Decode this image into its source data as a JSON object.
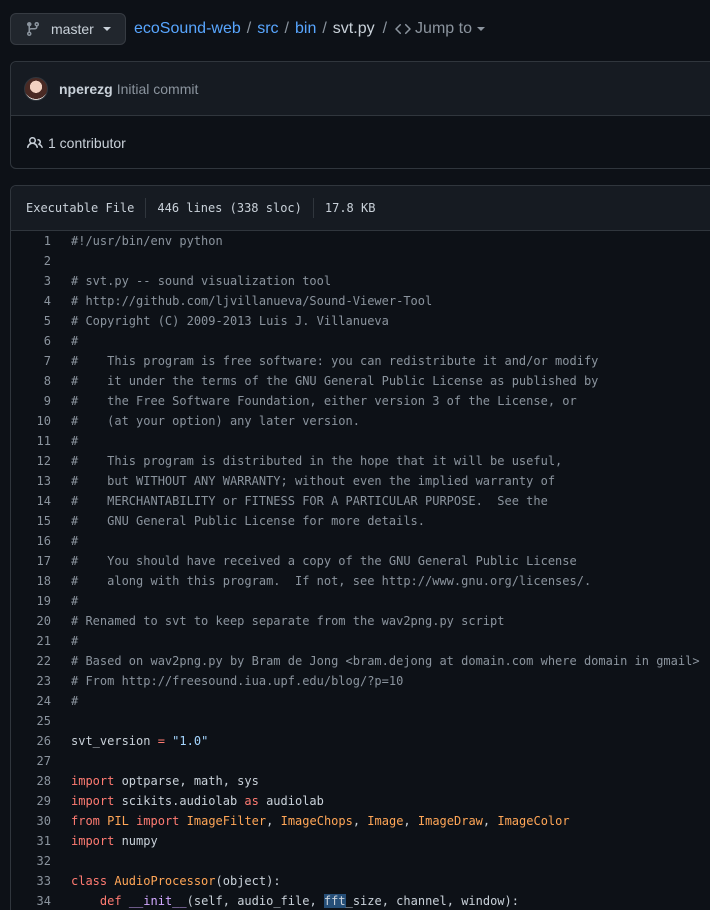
{
  "branch": {
    "name": "master",
    "icon": "git-branch-icon"
  },
  "breadcrumb": {
    "repo": "ecoSound-web",
    "parts": [
      "src",
      "bin"
    ],
    "file": "svt.py",
    "jump_label": "Jump to"
  },
  "commit": {
    "author": "nperezg",
    "message": "Initial commit"
  },
  "contributors": {
    "label": "1 contributor"
  },
  "file_info": {
    "mode": "Executable File",
    "lines": "446 lines (338 sloc)",
    "size": "17.8 KB"
  },
  "code_lines": [
    {
      "n": "1",
      "html": "<span class=\"c\">#!/usr/bin/env python</span>"
    },
    {
      "n": "2",
      "html": ""
    },
    {
      "n": "3",
      "html": "<span class=\"c\"># svt.py -- sound visualization tool</span>"
    },
    {
      "n": "4",
      "html": "<span class=\"c\"># http://github.com/ljvillanueva/Sound-Viewer-Tool</span>"
    },
    {
      "n": "5",
      "html": "<span class=\"c\"># Copyright (C) 2009-2013 Luis J. Villanueva</span>"
    },
    {
      "n": "6",
      "html": "<span class=\"c\">#</span>"
    },
    {
      "n": "7",
      "html": "<span class=\"c\">#    This program is free software: you can redistribute it and/or modify</span>"
    },
    {
      "n": "8",
      "html": "<span class=\"c\">#    it under the terms of the GNU General Public License as published by</span>"
    },
    {
      "n": "9",
      "html": "<span class=\"c\">#    the Free Software Foundation, either version 3 of the License, or</span>"
    },
    {
      "n": "10",
      "html": "<span class=\"c\">#    (at your option) any later version.</span>"
    },
    {
      "n": "11",
      "html": "<span class=\"c\">#</span>"
    },
    {
      "n": "12",
      "html": "<span class=\"c\">#    This program is distributed in the hope that it will be useful,</span>"
    },
    {
      "n": "13",
      "html": "<span class=\"c\">#    but WITHOUT ANY WARRANTY; without even the implied warranty of</span>"
    },
    {
      "n": "14",
      "html": "<span class=\"c\">#    MERCHANTABILITY or FITNESS FOR A PARTICULAR PURPOSE.  See the</span>"
    },
    {
      "n": "15",
      "html": "<span class=\"c\">#    GNU General Public License for more details.</span>"
    },
    {
      "n": "16",
      "html": "<span class=\"c\">#</span>"
    },
    {
      "n": "17",
      "html": "<span class=\"c\">#    You should have received a copy of the GNU General Public License</span>"
    },
    {
      "n": "18",
      "html": "<span class=\"c\">#    along with this program.  If not, see http://www.gnu.org/licenses/.</span>"
    },
    {
      "n": "19",
      "html": "<span class=\"c\">#</span>"
    },
    {
      "n": "20",
      "html": "<span class=\"c\"># Renamed to svt to keep separate from the wav2png.py script</span>"
    },
    {
      "n": "21",
      "html": "<span class=\"c\">#</span>"
    },
    {
      "n": "22",
      "html": "<span class=\"c\"># Based on wav2png.py by Bram de Jong &lt;bram.dejong at domain.com where domain in gmail&gt;</span>"
    },
    {
      "n": "23",
      "html": "<span class=\"c\"># From http://freesound.iua.upf.edu/blog/?p=10</span>"
    },
    {
      "n": "24",
      "html": "<span class=\"c\">#</span>"
    },
    {
      "n": "25",
      "html": ""
    },
    {
      "n": "26",
      "html": "svt_version <span class=\"k\">=</span> <span class=\"s\">\"1.0\"</span>"
    },
    {
      "n": "27",
      "html": ""
    },
    {
      "n": "28",
      "html": "<span class=\"k\">import</span> optparse, math, sys"
    },
    {
      "n": "29",
      "html": "<span class=\"k\">import</span> scikits.audiolab <span class=\"k\">as</span> audiolab"
    },
    {
      "n": "30",
      "html": "<span class=\"k\">from</span> <span class=\"o\">PIL</span> <span class=\"k\">import</span> <span class=\"o\">ImageFilter</span>, <span class=\"o\">ImageChops</span>, <span class=\"o\">Image</span>, <span class=\"o\">ImageDraw</span>, <span class=\"o\">ImageColor</span>"
    },
    {
      "n": "31",
      "html": "<span class=\"k\">import</span> numpy"
    },
    {
      "n": "32",
      "html": ""
    },
    {
      "n": "33",
      "html": "<span class=\"k\">class</span> <span class=\"o\">AudioProcessor</span>(object):"
    },
    {
      "n": "34",
      "html": "    <span class=\"k\">def</span> <span class=\"f\">__init__</span>(self, audio_file, <span class=\"sel\">fft</span>_size, channel, window):"
    }
  ]
}
